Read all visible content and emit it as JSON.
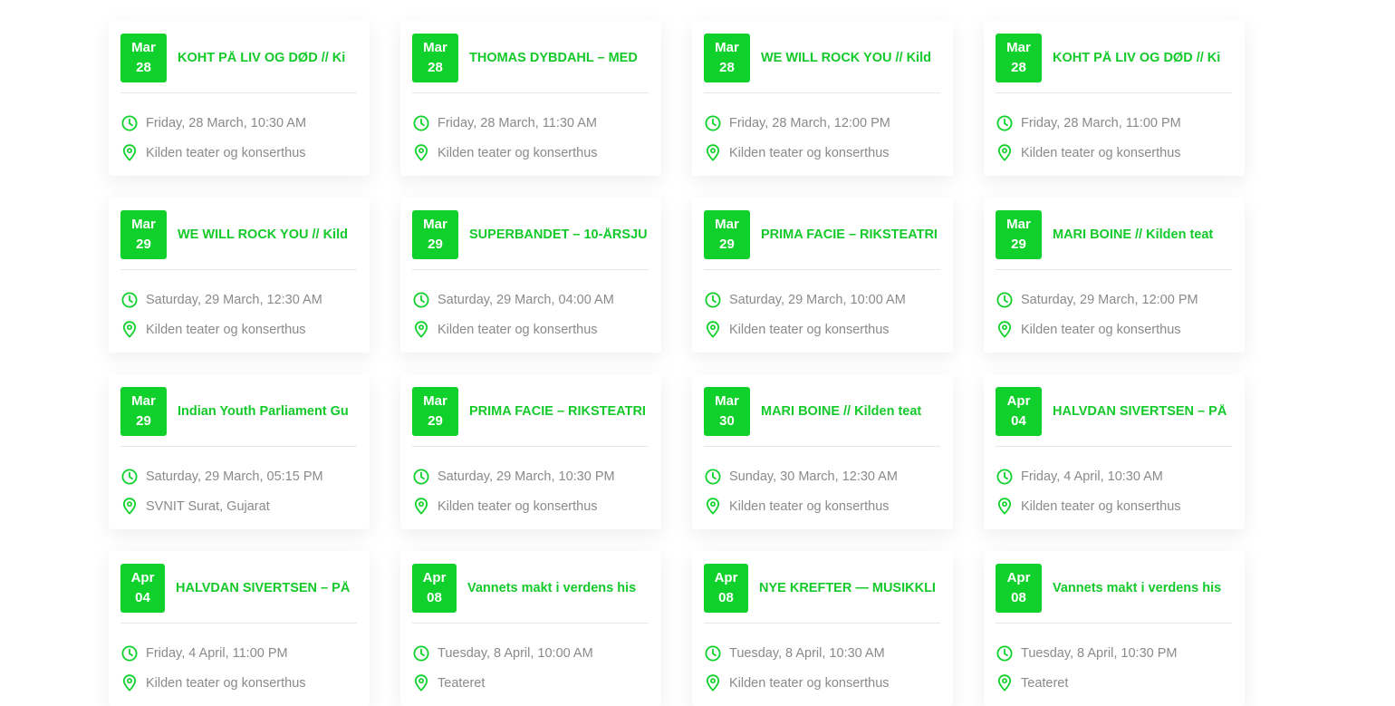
{
  "colors": {
    "accent": "#10d12b",
    "title": "#14c92a",
    "meta_text": "#8a8a8a"
  },
  "events": [
    {
      "month": "Mar",
      "day": "28",
      "title": "KOHT PÅ LIV OG DØD // Ki",
      "time": "Friday, 28 March, 10:30 AM",
      "venue": "Kilden teater og konserthus"
    },
    {
      "month": "Mar",
      "day": "28",
      "title": "THOMAS DYBDAHL – MED",
      "time": "Friday, 28 March, 11:30 AM",
      "venue": "Kilden teater og konserthus"
    },
    {
      "month": "Mar",
      "day": "28",
      "title": "WE WILL ROCK YOU // Kild",
      "time": "Friday, 28 March, 12:00 PM",
      "venue": "Kilden teater og konserthus"
    },
    {
      "month": "Mar",
      "day": "28",
      "title": "KOHT PÅ LIV OG DØD // Ki",
      "time": "Friday, 28 March, 11:00 PM",
      "venue": "Kilden teater og konserthus"
    },
    {
      "month": "Mar",
      "day": "29",
      "title": "WE WILL ROCK YOU // Kild",
      "time": "Saturday, 29 March, 12:30 AM",
      "venue": "Kilden teater og konserthus"
    },
    {
      "month": "Mar",
      "day": "29",
      "title": "SUPERBANDET – 10-ÅRSJU",
      "time": "Saturday, 29 March, 04:00 AM",
      "venue": "Kilden teater og konserthus"
    },
    {
      "month": "Mar",
      "day": "29",
      "title": "PRIMA FACIE – RIKSTEATRI",
      "time": "Saturday, 29 March, 10:00 AM",
      "venue": "Kilden teater og konserthus"
    },
    {
      "month": "Mar",
      "day": "29",
      "title": "MARI BOINE // Kilden teat",
      "time": "Saturday, 29 March, 12:00 PM",
      "venue": "Kilden teater og konserthus"
    },
    {
      "month": "Mar",
      "day": "29",
      "title": "Indian Youth Parliament Gu",
      "time": "Saturday, 29 March, 05:15 PM",
      "venue": "SVNIT Surat, Gujarat"
    },
    {
      "month": "Mar",
      "day": "29",
      "title": "PRIMA FACIE – RIKSTEATRI",
      "time": "Saturday, 29 March, 10:30 PM",
      "venue": "Kilden teater og konserthus"
    },
    {
      "month": "Mar",
      "day": "30",
      "title": "MARI BOINE // Kilden teat",
      "time": "Sunday, 30 March, 12:30 AM",
      "venue": "Kilden teater og konserthus"
    },
    {
      "month": "Apr",
      "day": "04",
      "title": "HALVDAN SIVERTSEN – PÅ",
      "time": "Friday, 4 April, 10:30 AM",
      "venue": "Kilden teater og konserthus"
    },
    {
      "month": "Apr",
      "day": "04",
      "title": "HALVDAN SIVERTSEN – PÅ",
      "time": "Friday, 4 April, 11:00 PM",
      "venue": "Kilden teater og konserthus"
    },
    {
      "month": "Apr",
      "day": "08",
      "title": "Vannets makt i verdens his",
      "time": "Tuesday, 8 April, 10:00 AM",
      "venue": "Teateret"
    },
    {
      "month": "Apr",
      "day": "08",
      "title": "NYE KREFTER — MUSIKKLI",
      "time": "Tuesday, 8 April, 10:30 AM",
      "venue": "Kilden teater og konserthus"
    },
    {
      "month": "Apr",
      "day": "08",
      "title": "Vannets makt i verdens his",
      "time": "Tuesday, 8 April, 10:30 PM",
      "venue": "Teateret"
    }
  ]
}
